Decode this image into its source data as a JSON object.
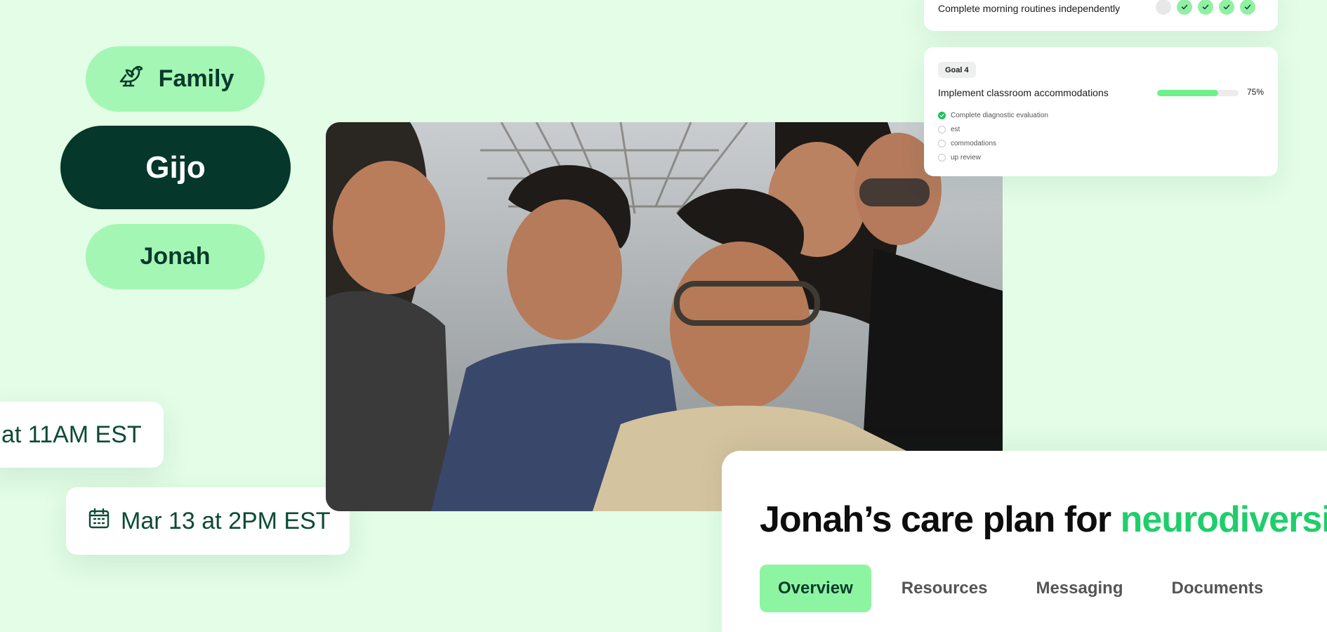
{
  "people": {
    "family_label": "Family",
    "selected_person": "Gijo",
    "other_person": "Jonah",
    "family_icon": "bird-icon"
  },
  "appointments": [
    {
      "text": "at 11AM EST"
    },
    {
      "text": "Mar 13 at 2PM EST",
      "icon": "calendar-icon"
    }
  ],
  "photo": {
    "description_icon": "family-photo"
  },
  "goals": {
    "routine": {
      "title": "Complete morning routines independently",
      "steps": [
        "empty",
        "done",
        "done",
        "done",
        "done"
      ]
    },
    "goal4": {
      "badge": "Goal 4",
      "title": "Implement classroom accommodations",
      "progress_percent": 75,
      "progress_label": "75%",
      "subtasks": [
        {
          "text": "Complete diagnostic evaluation",
          "done": true
        },
        {
          "text": "est",
          "done": false
        },
        {
          "text": "commodations",
          "done": false
        },
        {
          "text": "up review",
          "done": false
        }
      ]
    }
  },
  "care_plan": {
    "title_prefix": "Jonah’s care plan for ",
    "title_accent": "neurodiversity",
    "tabs": [
      "Overview",
      "Resources",
      "Messaging",
      "Documents"
    ],
    "active_tab": "Overview"
  },
  "colors": {
    "background": "#e3fde6",
    "pill_light": "#a4f6b4",
    "pill_dark": "#05372a",
    "accent": "#1fce6a",
    "progress": "#6ef08a"
  }
}
